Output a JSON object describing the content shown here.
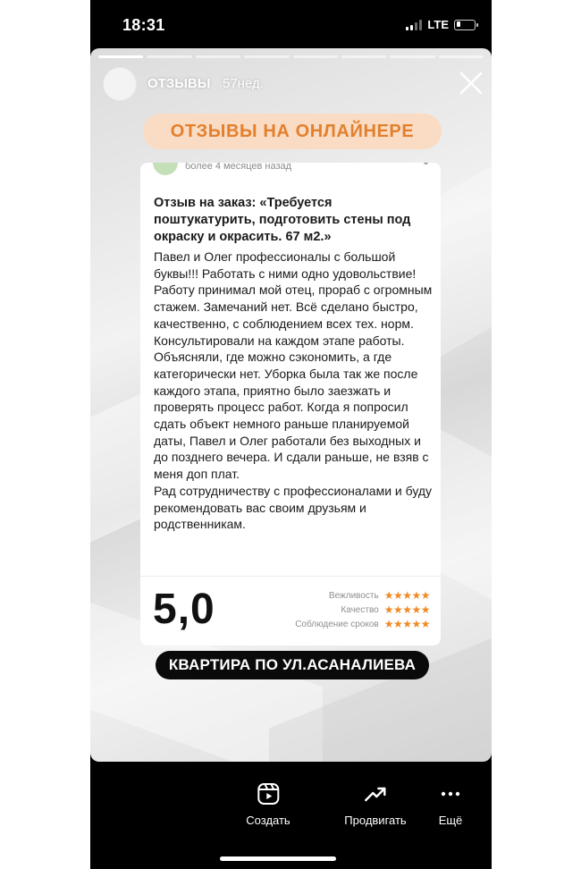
{
  "status_bar": {
    "time": "18:31",
    "network": "LTE",
    "battery_level": 0.2
  },
  "story": {
    "progress_segments": 8,
    "active_segment": 1,
    "username": "ОТЗЫВЫ",
    "age": "57нед.",
    "headline": "ОТЗЫВЫ НА ОНЛАЙНЕРЕ",
    "review": {
      "meta": "более 4 месяцев назад",
      "title": "Отзыв на заказ: «Требуется поштукатурить, подготовить стены под окраску и окрасить. 67 м2.»",
      "body": "Павел и Олег профессионалы с большой буквы!!! Работать с ними одно удовольствие! Работу принимал мой отец, прораб с огромным стажем. Замечаний нет. Всё сделано быстро, качественно, с соблюдением всех тех. норм. Консультировали на каждом этапе работы. Объясняли, где можно сэкономить, а где категорически нет. Уборка была так же после каждого этапа, приятно было заезжать и проверять процесс работ. Когда я попросил сдать объект немного раньше планируемой даты, Павел и Олег работали без выходных и до позднего вечера. И сдали раньше, не взяв с меня доп плат.",
      "closing": "Рад сотрудничеству с профессионалами и буду рекомендовать вас своим друзьям и родственникам.",
      "score": "5,0",
      "ratings": [
        {
          "label": "Вежливость",
          "stars": "★★★★★",
          "value": 5
        },
        {
          "label": "Качество",
          "stars": "★★★★★",
          "value": 5
        },
        {
          "label": "Соблюдение сроков",
          "stars": "★★★★★",
          "value": 5
        }
      ]
    },
    "caption": "КВАРТИРА ПО УЛ.АСАНАЛИЕВА"
  },
  "toolbar": {
    "create_label": "Создать",
    "promote_label": "Продвигать",
    "more_label": "Ещё"
  },
  "colors": {
    "headline_text": "#e2802e",
    "headline_bg": "#f9dcc3",
    "stars": "#f08a24",
    "caption_bg": "#0a0a0a"
  },
  "icons": [
    "close-icon",
    "reels-create-icon",
    "trending-up-icon",
    "more-dots-icon",
    "signal-icon",
    "battery-icon"
  ]
}
